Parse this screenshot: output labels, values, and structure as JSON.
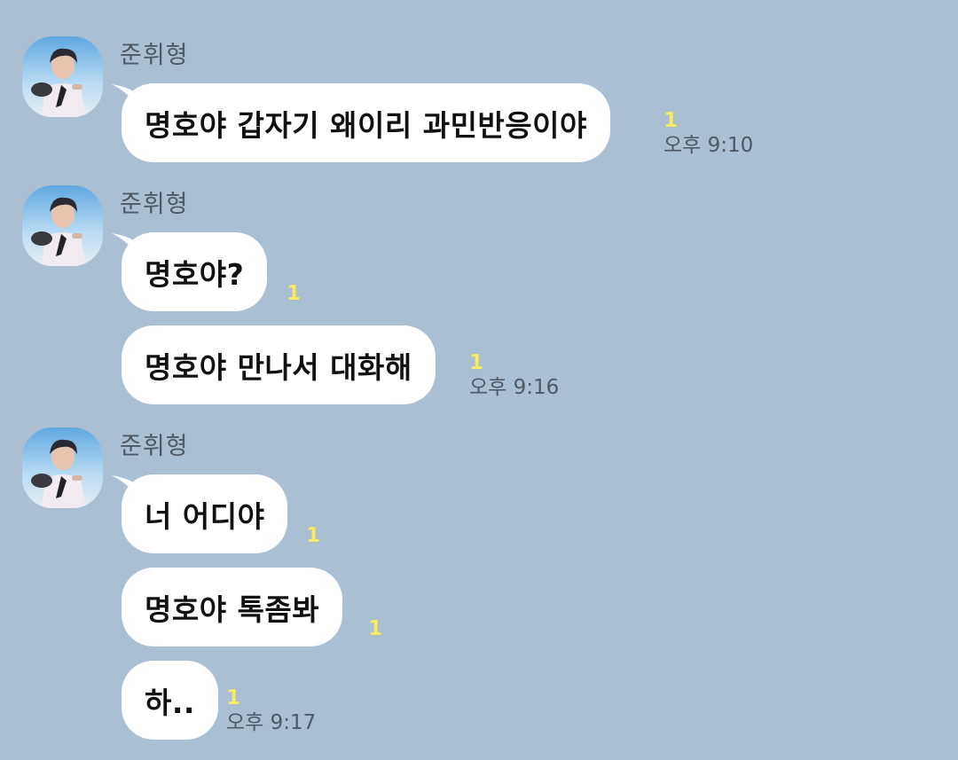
{
  "colors": {
    "background": "#abbfd2",
    "bubble": "#ffffff",
    "unread": "#f4ea6e",
    "meta_text": "#4e5963"
  },
  "groups": [
    {
      "sender": "준휘형",
      "messages": [
        {
          "text": "명호야 갑자기 왜이리 과민반응이야",
          "unread": "1",
          "time": "오후 9:10"
        }
      ]
    },
    {
      "sender": "준휘형",
      "messages": [
        {
          "text": "명호야?",
          "unread": "1",
          "time": ""
        },
        {
          "text": "명호야 만나서 대화해",
          "unread": "1",
          "time": "오후 9:16"
        }
      ]
    },
    {
      "sender": "준휘형",
      "messages": [
        {
          "text": "너 어디야",
          "unread": "1",
          "time": ""
        },
        {
          "text": "명호야 톡좀봐",
          "unread": "1",
          "time": ""
        },
        {
          "text": "하..",
          "unread": "1",
          "time": "오후 9:17"
        }
      ]
    }
  ]
}
